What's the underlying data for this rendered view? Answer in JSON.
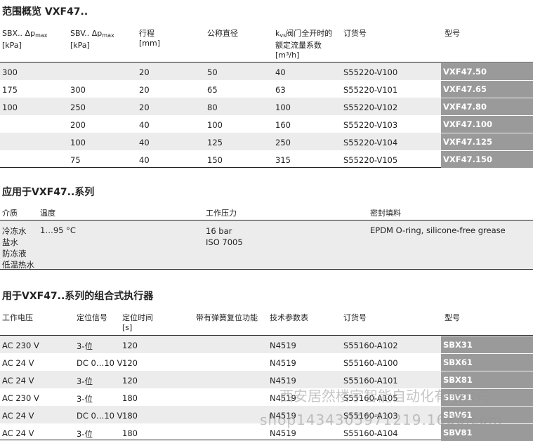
{
  "section1": {
    "title": "范围概览 VXF47..",
    "headers": {
      "sbx": "SBX.. Δp",
      "sbx_sub": "max",
      "sbx_unit": "[kPa]",
      "sbv": "SBV.. Δp",
      "sbv_sub": "max",
      "sbv_unit": "[kPa]",
      "stroke": "行程",
      "stroke_unit": "[mm]",
      "dn": "公称直径",
      "kvs_k": "k",
      "kvs_sub": "vs",
      "kvs_l1": "阀门全开时的",
      "kvs_l2": "额定流量系数",
      "kvs_unit": "[m³/h]",
      "order": "订货号",
      "model": "型号"
    },
    "rows": [
      {
        "sbx": "300",
        "sbv": "",
        "stroke": "20",
        "dn": "50",
        "kvs": "40",
        "order": "S55220-V100",
        "model": "VXF47.50"
      },
      {
        "sbx": "175",
        "sbv": "300",
        "stroke": "20",
        "dn": "65",
        "kvs": "63",
        "order": "S55220-V101",
        "model": "VXF47.65"
      },
      {
        "sbx": "100",
        "sbv": "250",
        "stroke": "20",
        "dn": "80",
        "kvs": "100",
        "order": "S55220-V102",
        "model": "VXF47.80"
      },
      {
        "sbx": "",
        "sbv": "200",
        "stroke": "40",
        "dn": "100",
        "kvs": "160",
        "order": "S55220-V103",
        "model": "VXF47.100"
      },
      {
        "sbx": "",
        "sbv": "100",
        "stroke": "40",
        "dn": "125",
        "kvs": "250",
        "order": "S55220-V104",
        "model": "VXF47.125"
      },
      {
        "sbx": "",
        "sbv": "75",
        "stroke": "40",
        "dn": "150",
        "kvs": "315",
        "order": "S55220-V105",
        "model": "VXF47.150"
      }
    ]
  },
  "section2": {
    "title": "应用于VXF47..系列",
    "headers": {
      "medium": "介质",
      "temp": "温度",
      "pressure": "工作压力",
      "seal": "密封填料"
    },
    "media": [
      "冷冻水",
      "盐水",
      "防冻液",
      "低温热水"
    ],
    "temp": "1…95 °C",
    "pressure": [
      "16 bar",
      "ISO 7005"
    ],
    "seal": "EPDM O-ring, silicone-free grease"
  },
  "section3": {
    "title": "用于VXF47..系列的组合式执行器",
    "headers": {
      "voltage": "工作电压",
      "signal": "定位信号",
      "time": "定位时间",
      "time_unit": "[s]",
      "spring": "带有弹簧复位功能",
      "datasheet": "技术参数表",
      "order": "订货号",
      "model": "型号"
    },
    "rows": [
      {
        "voltage": "AC 230 V",
        "signal": "3-位",
        "time": "120",
        "datasheet": "N4519",
        "order": "S55160-A102",
        "model": "SBX31"
      },
      {
        "voltage": "AC 24 V",
        "signal": "DC 0…10 V",
        "time": "120",
        "datasheet": "N4519",
        "order": "S55160-A100",
        "model": "SBX61"
      },
      {
        "voltage": "AC 24 V",
        "signal": "3-位",
        "time": "120",
        "datasheet": "N4519",
        "order": "S55160-A101",
        "model": "SBX81"
      },
      {
        "voltage": "AC 230 V",
        "signal": "3-位",
        "time": "180",
        "datasheet": "N4519",
        "order": "S55160-A105",
        "model": "SBV31"
      },
      {
        "voltage": "AC 24 V",
        "signal": "DC 0…10 V",
        "time": "180",
        "datasheet": "N4519",
        "order": "S55160-A103",
        "model": "SBV61"
      },
      {
        "voltage": "AC 24 V",
        "signal": "3-位",
        "time": "180",
        "datasheet": "N4519",
        "order": "S55160-A104",
        "model": "SBV81"
      }
    ]
  },
  "watermark": {
    "line1": "西安居然楼宇智能自动化有限公司",
    "line2": "shop1434305971219.1688.com"
  }
}
